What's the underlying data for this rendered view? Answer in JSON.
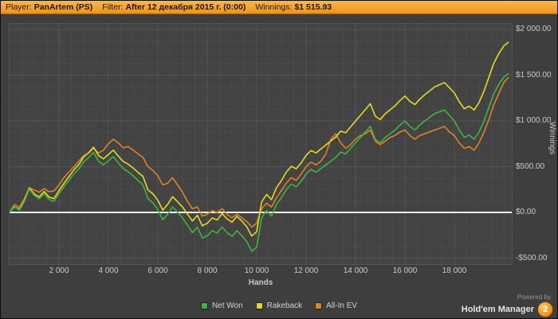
{
  "title_bar": {
    "player_label": "Player:",
    "player_value": "PanArtem (PS)",
    "filter_label": "Filter:",
    "filter_value": "After 12 декабря 2015 г. (0:00)",
    "winnings_label": "Winnings:",
    "winnings_value": "$1 515.93"
  },
  "footer": {
    "powered_by": "Powered by",
    "brand": "Hold'em Manager",
    "brand_badge": "2"
  },
  "chart_data": {
    "type": "line",
    "title": "",
    "xlabel": "Hands",
    "ylabel": "Winnings",
    "x_range": [
      0,
      20322
    ],
    "y_range": [
      -565,
      2061
    ],
    "x_ticks": [
      2000,
      4000,
      6000,
      8000,
      10000,
      12000,
      14000,
      16000,
      18000
    ],
    "x_tick_labels": [
      "2 000",
      "4 000",
      "6 000",
      "8 000",
      "10 000",
      "12 000",
      "14 000",
      "16 000",
      "18 000"
    ],
    "y_ticks": [
      2000,
      1500,
      1000,
      500,
      0,
      -500
    ],
    "y_tick_labels": [
      "$2 000.00",
      "$1 500.00",
      "$1 000.00",
      "$500.00",
      "$0.00",
      "-$500.00"
    ],
    "grid": {
      "minor_x": 500,
      "minor_y": 125,
      "minor_color": "#4a4a4a",
      "major_color": "#545454"
    },
    "zero_line": true,
    "zero_line_color": "#f2f2f2",
    "legend_position": "bottom",
    "hands_step": 200,
    "series": [
      {
        "name": "Net Won",
        "color": "#3eb43e",
        "values": [
          0,
          60,
          25,
          120,
          255,
          185,
          150,
          205,
          140,
          120,
          205,
          280,
          350,
          420,
          475,
          555,
          600,
          655,
          560,
          520,
          565,
          610,
          540,
          480,
          445,
          400,
          350,
          300,
          150,
          105,
          30,
          -80,
          -20,
          60,
          0,
          -60,
          -140,
          -220,
          -160,
          -280,
          -255,
          -200,
          -225,
          -160,
          -220,
          -260,
          -200,
          -255,
          -320,
          -425,
          -380,
          -60,
          20,
          -40,
          85,
          160,
          250,
          310,
          280,
          340,
          420,
          470,
          440,
          480,
          520,
          560,
          600,
          660,
          640,
          700,
          760,
          820,
          880,
          940,
          800,
          760,
          820,
          860,
          900,
          955,
          1000,
          940,
          900,
          955,
          1000,
          1040,
          1080,
          1100,
          1120,
          1060,
          1000,
          900,
          820,
          845,
          800,
          880,
          1000,
          1150,
          1300,
          1400,
          1480,
          1520
        ]
      },
      {
        "name": "Rakeback",
        "color": "#e4da22",
        "values": [
          0,
          63,
          32,
          130,
          269,
          202,
          170,
          229,
          167,
          151,
          239,
          317,
          391,
          464,
          523,
          606,
          654,
          713,
          621,
          585,
          633,
          681,
          615,
          558,
          527,
          485,
          438,
          392,
          245,
          204,
          132,
          25,
          89,
          172,
          116,
          59,
          -18,
          -94,
          -31,
          -147,
          -119,
          -61,
          -82,
          -14,
          -70,
          -107,
          -44,
          -95,
          -157,
          -258,
          -210,
          113,
          197,
          140,
          269,
          347,
          440,
          504,
          477,
          541,
          624,
          677,
          651,
          694,
          738,
          781,
          824,
          888,
          871,
          935,
          998,
          1061,
          1125,
          1188,
          1052,
          1015,
          1078,
          1122,
          1165,
          1224,
          1272,
          1215,
          1179,
          1237,
          1286,
          1329,
          1372,
          1396,
          1419,
          1363,
          1306,
          1209,
          1133,
          1161,
          1120,
          1203,
          1326,
          1480,
          1633,
          1737,
          1820,
          1863
        ]
      },
      {
        "name": "All-In EV",
        "color": "#e08125",
        "values": [
          0,
          85,
          55,
          150,
          265,
          245,
          220,
          260,
          225,
          235,
          300,
          380,
          440,
          500,
          560,
          620,
          650,
          700,
          650,
          680,
          750,
          800,
          760,
          705,
          720,
          680,
          640,
          600,
          500,
          460,
          400,
          300,
          320,
          380,
          300,
          220,
          120,
          40,
          60,
          -40,
          -20,
          20,
          0,
          40,
          -20,
          -60,
          -20,
          -60,
          -100,
          -160,
          -120,
          40,
          100,
          60,
          160,
          240,
          320,
          380,
          350,
          420,
          500,
          550,
          520,
          560,
          640,
          800,
          860,
          760,
          700,
          740,
          800,
          840,
          860,
          900,
          780,
          740,
          780,
          820,
          840,
          880,
          900,
          840,
          800,
          840,
          860,
          880,
          900,
          920,
          940,
          880,
          840,
          760,
          700,
          720,
          680,
          760,
          880,
          1020,
          1180,
          1300,
          1420,
          1480
        ]
      }
    ]
  }
}
